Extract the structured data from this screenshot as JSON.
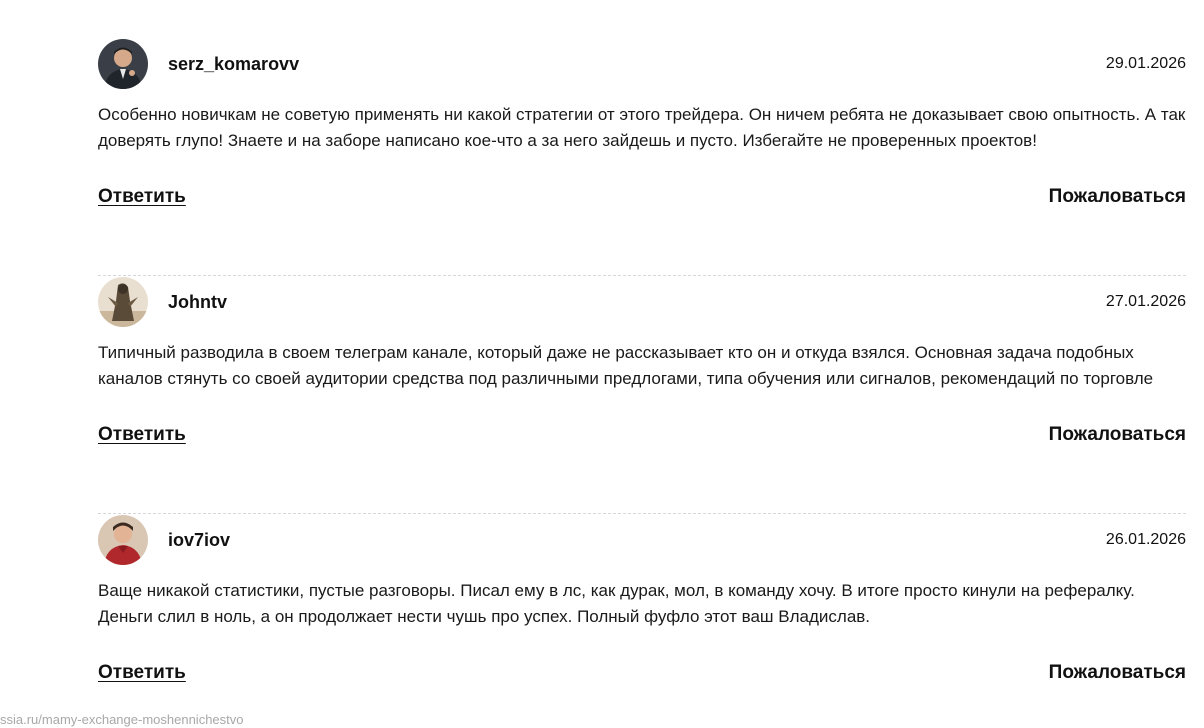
{
  "comments": [
    {
      "author": "serz_komarovv",
      "date": "29.01.2026",
      "text": "Особенно новичкам не советую применять ни какой стратегии от этого трейдера. Он ничем ребята не доказывает свою опытность. А так доверять глупо! Знаете и на заборе написано кое-что а за него зайдешь и пусто. Избегайте не проверенных проектов!",
      "reply_label": "Ответить",
      "report_label": "Пожаловаться"
    },
    {
      "author": "Johntv",
      "date": "27.01.2026",
      "text": "Типичный разводила в своем телеграм канале, который даже не рассказывает кто он и откуда взялся. Основная задача подобных каналов стянуть со своей аудитории средства под различными предлогами, типа обучения или сигналов, рекомендаций по торговле",
      "reply_label": "Ответить",
      "report_label": "Пожаловаться"
    },
    {
      "author": "iov7iov",
      "date": "26.01.2026",
      "text": "Ваще никакой статистики, пустые разговоры. Писал ему в лс, как дурак, мол, в команду хочу. В итоге просто кинули на рефералку. Деньги слил в ноль, а он продолжает нести чушь про успех. Полный фуфло этот ваш Владислав.",
      "reply_label": "Ответить",
      "report_label": "Пожаловаться"
    }
  ],
  "status_bar": {
    "url": "ssia.ru/mamy-exchange-moshennichestvo"
  }
}
